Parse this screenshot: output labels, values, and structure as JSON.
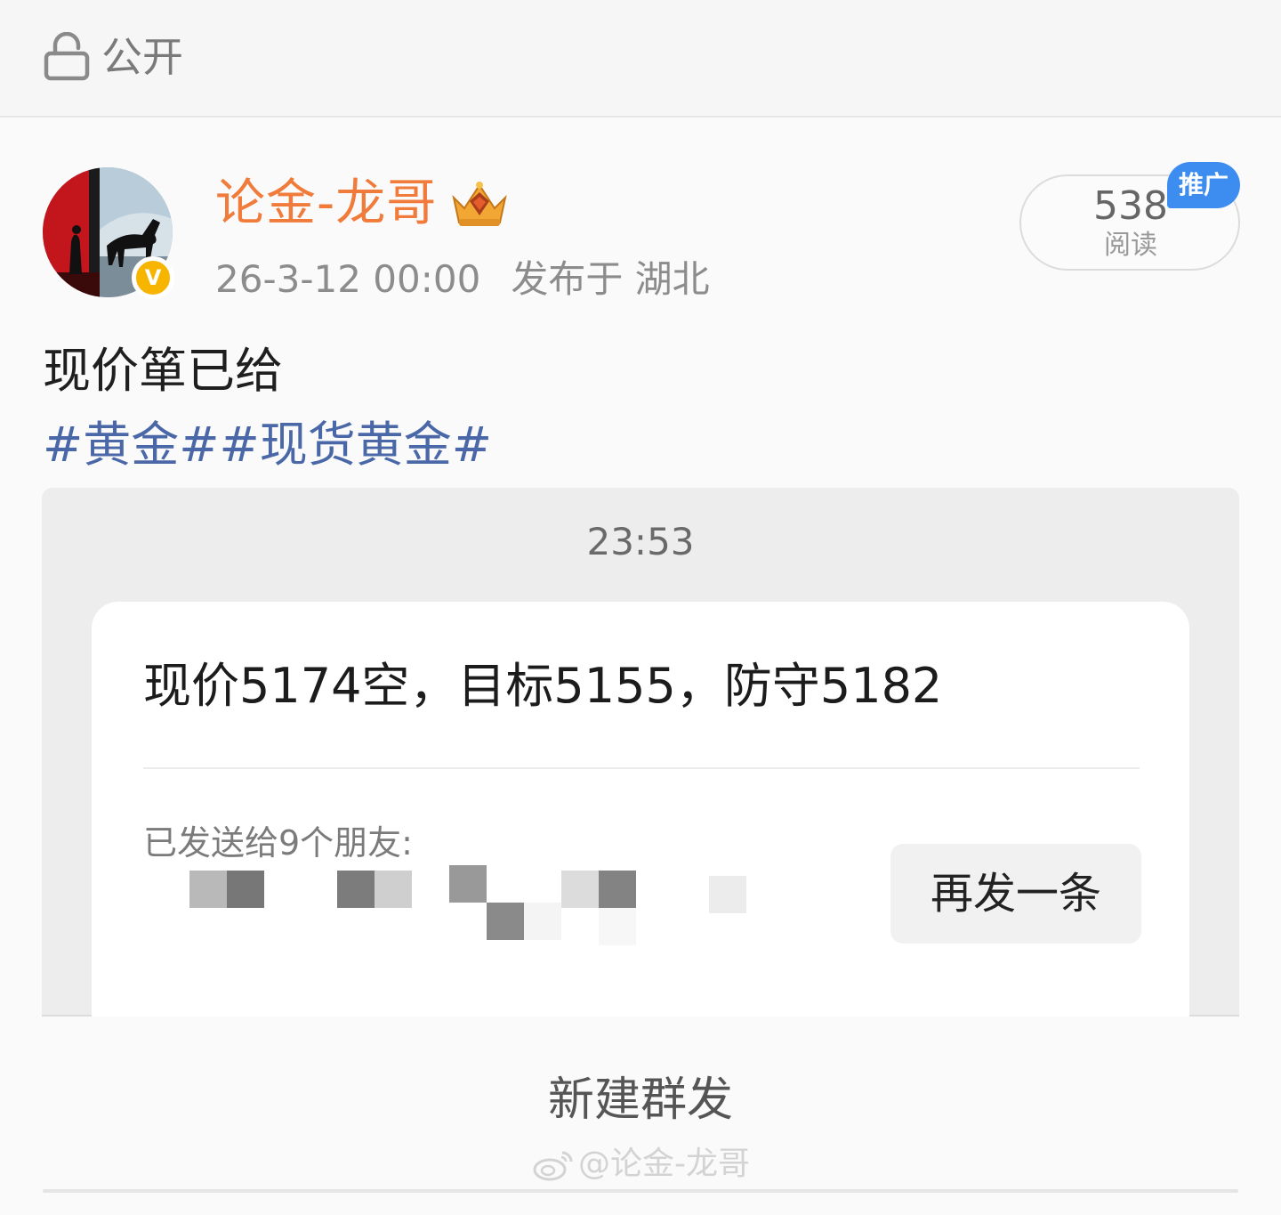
{
  "topbar": {
    "privacy_label": "公开",
    "icon": "lock-open-icon"
  },
  "post": {
    "author": {
      "name": "论金-龙哥",
      "verified_mark": "V",
      "crown_icon": "crown-icon"
    },
    "timestamp": "26-3-12 00:00",
    "location": "发布于 湖北",
    "reads": {
      "count": "538",
      "label": "阅读",
      "badge": "推广"
    },
    "text": "现价箪已给",
    "hashtags": "#黄金##现货黄金#"
  },
  "screenshot": {
    "time": "23:53",
    "message": "现价5174空，目标5155，防守5182",
    "sent_to": "已发送给9个朋友:",
    "resend_label": "再发一条"
  },
  "footer": {
    "new_broadcast": "新建群发",
    "watermark": "@论金-龙哥"
  },
  "colors": {
    "username": "#f07b3a",
    "hashtag": "#4a68a8",
    "promo": "#3d8df0",
    "verified": "#f7b500"
  }
}
